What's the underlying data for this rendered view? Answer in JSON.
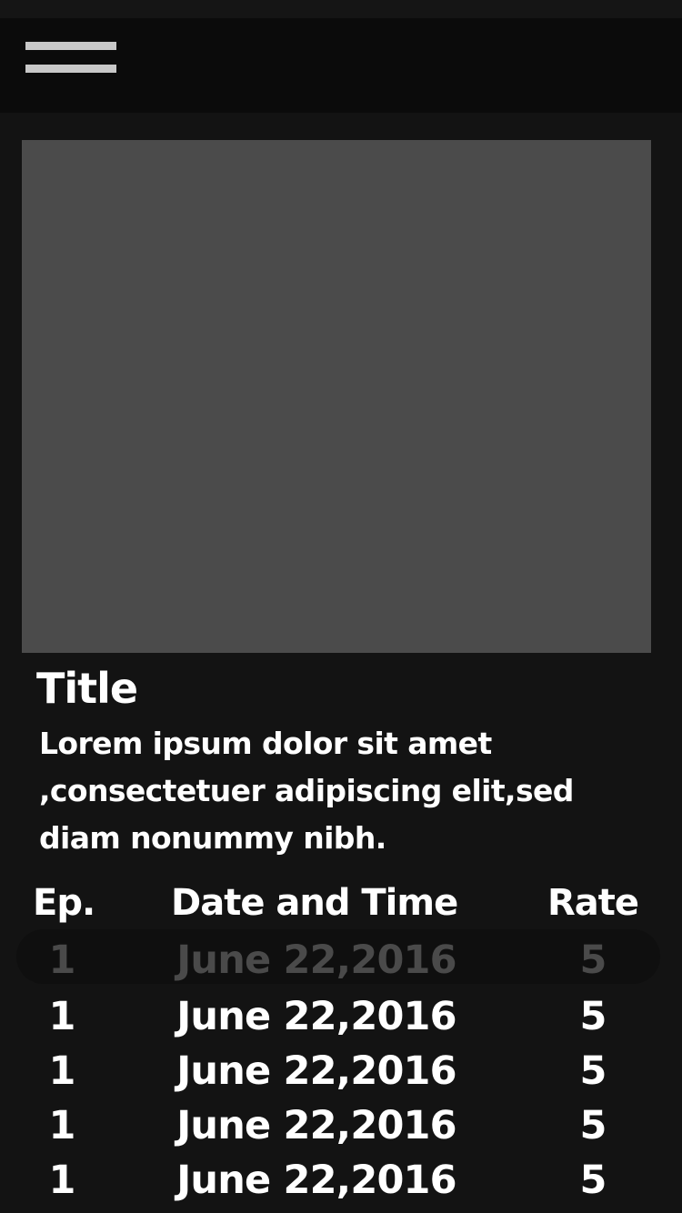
{
  "header": {
    "menu_icon": "hamburger-menu-icon"
  },
  "content": {
    "title": "Title",
    "description_lines": [
      "Lorem ipsum dolor sit amet",
      ",consectetuer adipiscing elit,sed",
      "diam nonummy nibh."
    ]
  },
  "table": {
    "headers": {
      "episode": "Ep.",
      "date": "Date and Time",
      "rate": "Rate"
    },
    "rows": [
      {
        "episode": "1",
        "date": "June 22,2016",
        "rate": "5"
      },
      {
        "episode": "1",
        "date": "June 22,2016",
        "rate": "5"
      },
      {
        "episode": "1",
        "date": "June 22,2016",
        "rate": "5"
      },
      {
        "episode": "1",
        "date": "June 22,2016",
        "rate": "5"
      },
      {
        "episode": "1",
        "date": "June 22,2016",
        "rate": "5"
      }
    ]
  },
  "colors": {
    "background": "#131313",
    "app_bar": "#0b0b0b",
    "image_placeholder": "#4b4b4b",
    "text": "#ffffff",
    "faded_text": "#4a4a4a"
  }
}
